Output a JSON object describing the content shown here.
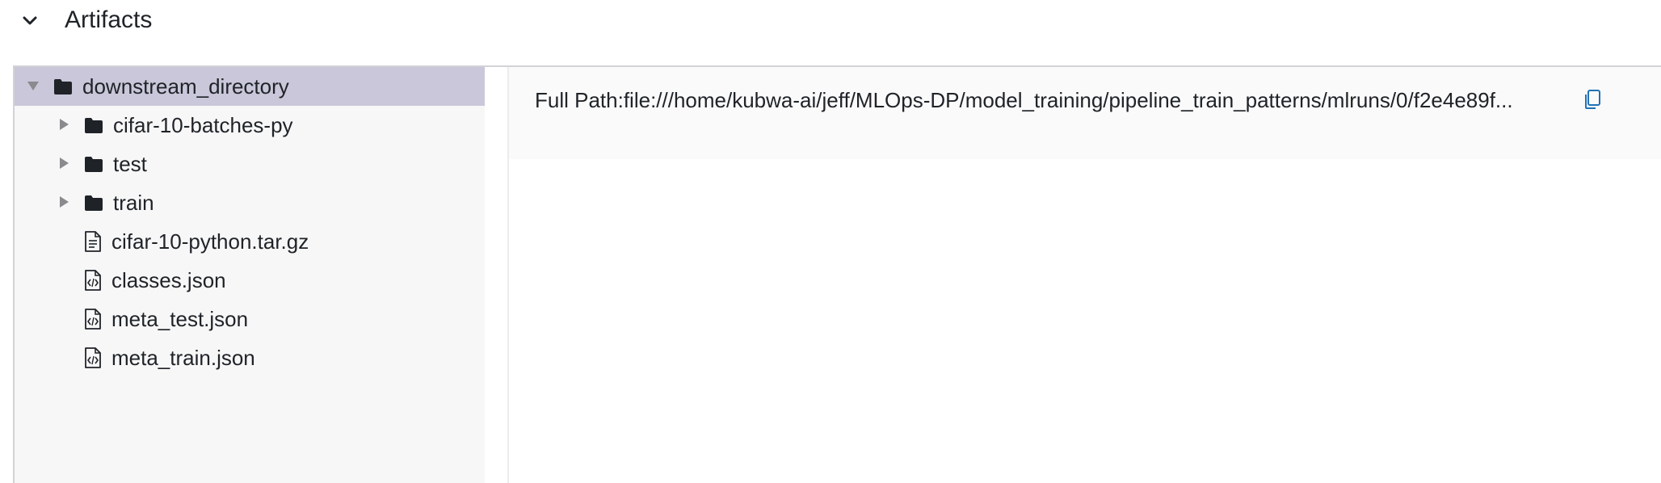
{
  "section": {
    "title": "Artifacts",
    "collapse_icon": "chevron-down-icon"
  },
  "tree": {
    "root": {
      "label": "downstream_directory",
      "icon": "folder-icon",
      "expanded": true,
      "selected": true
    },
    "items": [
      {
        "label": "cifar-10-batches-py",
        "type": "folder",
        "icon": "folder-icon"
      },
      {
        "label": "test",
        "type": "folder",
        "icon": "folder-icon"
      },
      {
        "label": "train",
        "type": "folder",
        "icon": "folder-icon"
      },
      {
        "label": "cifar-10-python.tar.gz",
        "type": "file",
        "icon": "file-text-icon"
      },
      {
        "label": "classes.json",
        "type": "file",
        "icon": "file-code-icon"
      },
      {
        "label": "meta_test.json",
        "type": "file",
        "icon": "file-code-icon"
      },
      {
        "label": "meta_train.json",
        "type": "file",
        "icon": "file-code-icon"
      }
    ]
  },
  "detail": {
    "full_path_text": "Full Path:file:///home/kubwa-ai/jeff/MLOps-DP/model_training/pipeline_train_patterns/mlruns/0/f2e4e89f...",
    "copy_icon": "copy-icon"
  },
  "colors": {
    "selected_row": "#c9c7d9",
    "tree_bg": "#f7f7f7",
    "path_bg": "#fafafa",
    "copy_icon": "#2272b4",
    "icon_dark": "#1f2328"
  }
}
